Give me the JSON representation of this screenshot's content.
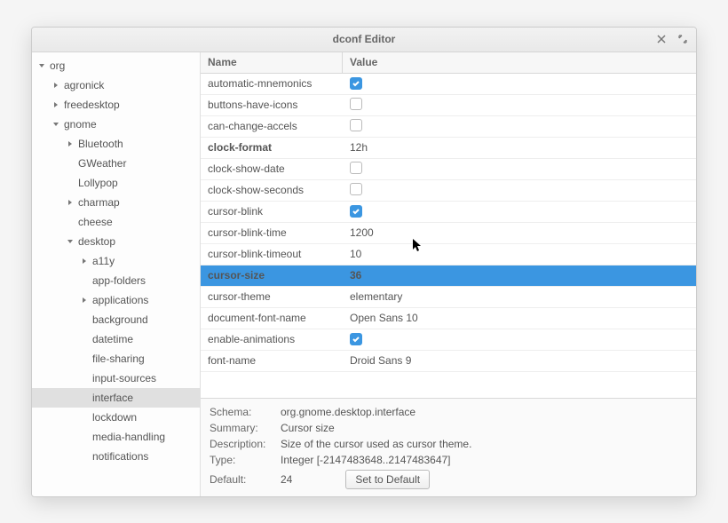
{
  "window": {
    "title": "dconf Editor"
  },
  "tree": [
    {
      "depth": 0,
      "expanded": true,
      "label": "org"
    },
    {
      "depth": 1,
      "expanded": false,
      "label": "agronick"
    },
    {
      "depth": 1,
      "expanded": false,
      "label": "freedesktop"
    },
    {
      "depth": 1,
      "expanded": true,
      "label": "gnome"
    },
    {
      "depth": 2,
      "expanded": false,
      "label": "Bluetooth"
    },
    {
      "depth": 2,
      "expanded": null,
      "label": "GWeather"
    },
    {
      "depth": 2,
      "expanded": null,
      "label": "Lollypop"
    },
    {
      "depth": 2,
      "expanded": false,
      "label": "charmap"
    },
    {
      "depth": 2,
      "expanded": null,
      "label": "cheese"
    },
    {
      "depth": 2,
      "expanded": true,
      "label": "desktop"
    },
    {
      "depth": 3,
      "expanded": false,
      "label": "a11y"
    },
    {
      "depth": 3,
      "expanded": null,
      "label": "app-folders"
    },
    {
      "depth": 3,
      "expanded": false,
      "label": "applications"
    },
    {
      "depth": 3,
      "expanded": null,
      "label": "background"
    },
    {
      "depth": 3,
      "expanded": null,
      "label": "datetime"
    },
    {
      "depth": 3,
      "expanded": null,
      "label": "file-sharing"
    },
    {
      "depth": 3,
      "expanded": null,
      "label": "input-sources"
    },
    {
      "depth": 3,
      "expanded": null,
      "label": "interface",
      "selected": true
    },
    {
      "depth": 3,
      "expanded": null,
      "label": "lockdown"
    },
    {
      "depth": 3,
      "expanded": null,
      "label": "media-handling"
    },
    {
      "depth": 3,
      "expanded": null,
      "label": "notifications"
    }
  ],
  "columns": {
    "name": "Name",
    "value": "Value"
  },
  "rows": [
    {
      "name": "automatic-mnemonics",
      "type": "bool",
      "value": true
    },
    {
      "name": "buttons-have-icons",
      "type": "bool",
      "value": false
    },
    {
      "name": "can-change-accels",
      "type": "bool",
      "value": false
    },
    {
      "name": "clock-format",
      "type": "text",
      "value": "12h",
      "bold": true
    },
    {
      "name": "clock-show-date",
      "type": "bool",
      "value": false
    },
    {
      "name": "clock-show-seconds",
      "type": "bool",
      "value": false
    },
    {
      "name": "cursor-blink",
      "type": "bool",
      "value": true
    },
    {
      "name": "cursor-blink-time",
      "type": "text",
      "value": "1200"
    },
    {
      "name": "cursor-blink-timeout",
      "type": "text",
      "value": "10"
    },
    {
      "name": "cursor-size",
      "type": "text",
      "value": "36",
      "selected": true
    },
    {
      "name": "cursor-theme",
      "type": "text",
      "value": "elementary"
    },
    {
      "name": "document-font-name",
      "type": "text",
      "value": "Open Sans 10"
    },
    {
      "name": "enable-animations",
      "type": "bool",
      "value": true
    },
    {
      "name": "font-name",
      "type": "text",
      "value": "Droid Sans 9"
    }
  ],
  "detail": {
    "schema_label": "Schema:",
    "schema": "org.gnome.desktop.interface",
    "summary_label": "Summary:",
    "summary": "Cursor size",
    "description_label": "Description:",
    "description": "Size of the cursor used as cursor theme.",
    "type_label": "Type:",
    "type": "Integer [-2147483648..2147483647]",
    "default_label": "Default:",
    "default": "24",
    "reset_button": "Set to Default"
  }
}
